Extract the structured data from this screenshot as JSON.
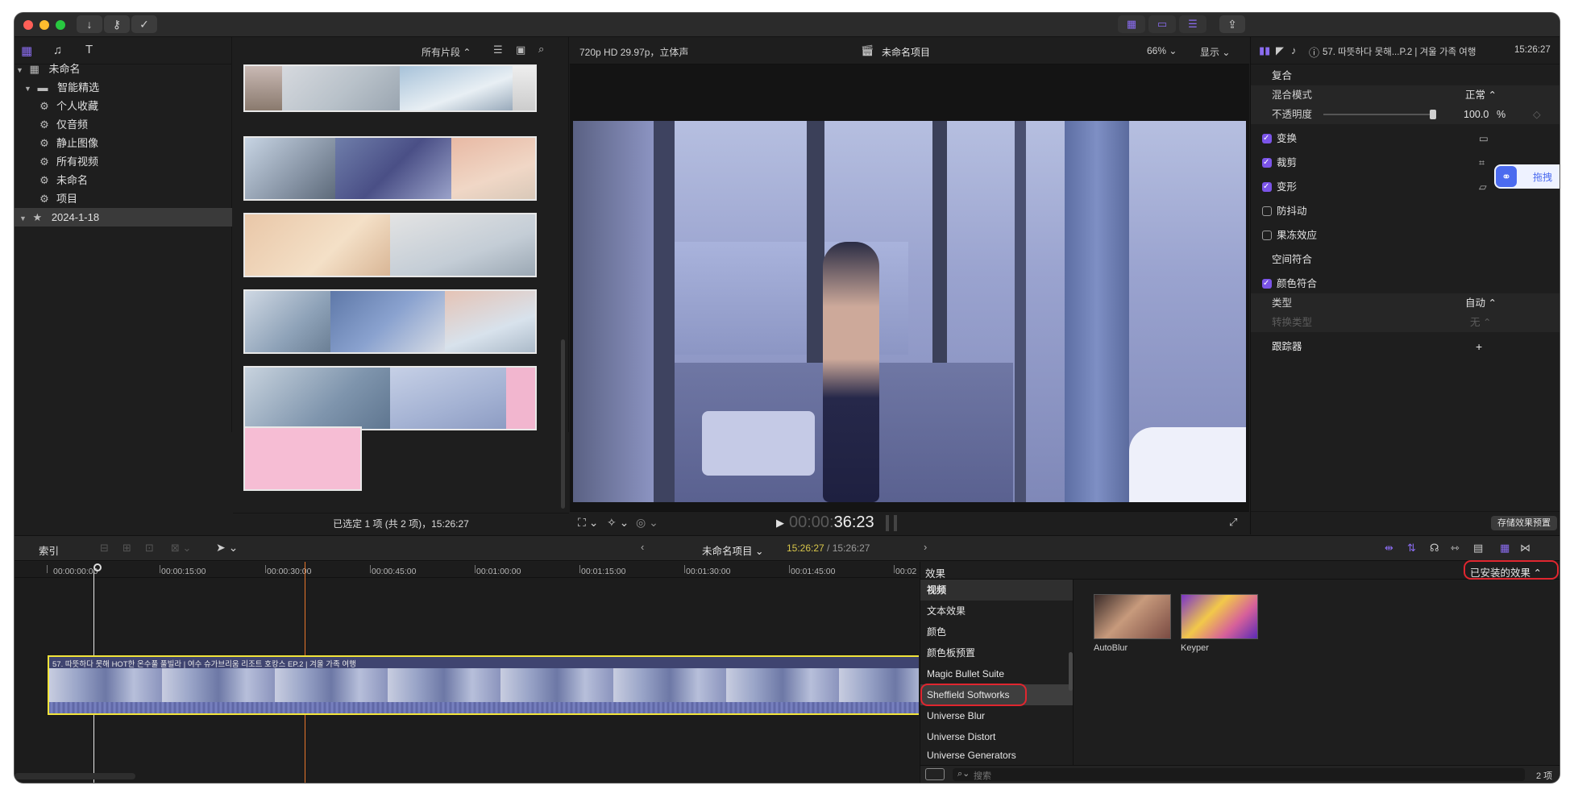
{
  "library": {
    "root": "未命名",
    "smart_collections_folder": "智能精选",
    "collections": [
      "个人收藏",
      "仅音频",
      "静止图像",
      "所有视频",
      "未命名",
      "项目"
    ],
    "event": "2024-1-18"
  },
  "browser": {
    "filter_label": "所有片段",
    "status": "已选定 1 项 (共 2 项)，15:26:27"
  },
  "viewer": {
    "format": "720p HD 29.97p，立体声",
    "project_title": "未命名项目",
    "zoom": "66%",
    "display_menu": "显示",
    "timecode_dim": "00:00:",
    "timecode_bright": "36:23"
  },
  "inspector": {
    "clip_title": "57. 따뜻하다 못해...P.2 | 겨울 가족 여행",
    "duration": "15:26:27",
    "section_composite": "复合",
    "blend_mode_label": "混合模式",
    "blend_mode_value": "正常",
    "opacity_label": "不透明度",
    "opacity_value": "100.0",
    "opacity_unit": "%",
    "opacity_fraction": 1.0,
    "transform": "变换",
    "crop": "裁剪",
    "distort": "变形",
    "stabilization": "防抖动",
    "rolling_shutter": "果冻效应",
    "spatial_conform": "空间符合",
    "color_conform": "颜色符合",
    "type_label": "类型",
    "type_value": "自动",
    "convert_label": "转换类型",
    "convert_value": "无",
    "tracker": "跟踪器",
    "tracker_add": "+",
    "save_preset": "存储效果预置",
    "floating_badge": "拖拽"
  },
  "timeline_bar": {
    "index": "索引",
    "project": "未命名项目",
    "position": "15:26:27",
    "separator": " / ",
    "duration": "15:26:27"
  },
  "ruler": [
    "00:00:00:00",
    "00:00:15:00",
    "00:00:30:00",
    "00:00:45:00",
    "00:01:00:00",
    "00:01:15:00",
    "00:01:30:00",
    "00:01:45:00",
    "00:02"
  ],
  "clip": {
    "title": "57. 따뜻하다 못해 HOT한 온수풀 풀빌라 | 여수 슈가브리움 리조트 호캉스 EP.2 | 겨울 가족 여행"
  },
  "effects": {
    "header": "效果",
    "dropdown": "已安装的效果",
    "categories": [
      "视频",
      "文本效果",
      "颜色",
      "颜色板预置",
      "Magic Bullet Suite",
      "Sheffield Softworks",
      "Universe Blur",
      "Universe Distort",
      "Universe Generators"
    ],
    "selected": "Sheffield Softworks",
    "items": [
      {
        "name": "AutoBlur"
      },
      {
        "name": "Keyper"
      }
    ],
    "search_placeholder": "搜索",
    "count": "2 项"
  },
  "colors": {
    "accent": "#7b54e8",
    "highlight_red": "#e0262f",
    "clip_border": "#f2e43a",
    "playhead": "#e8762c",
    "timecode_yellow": "#d8c64a"
  }
}
